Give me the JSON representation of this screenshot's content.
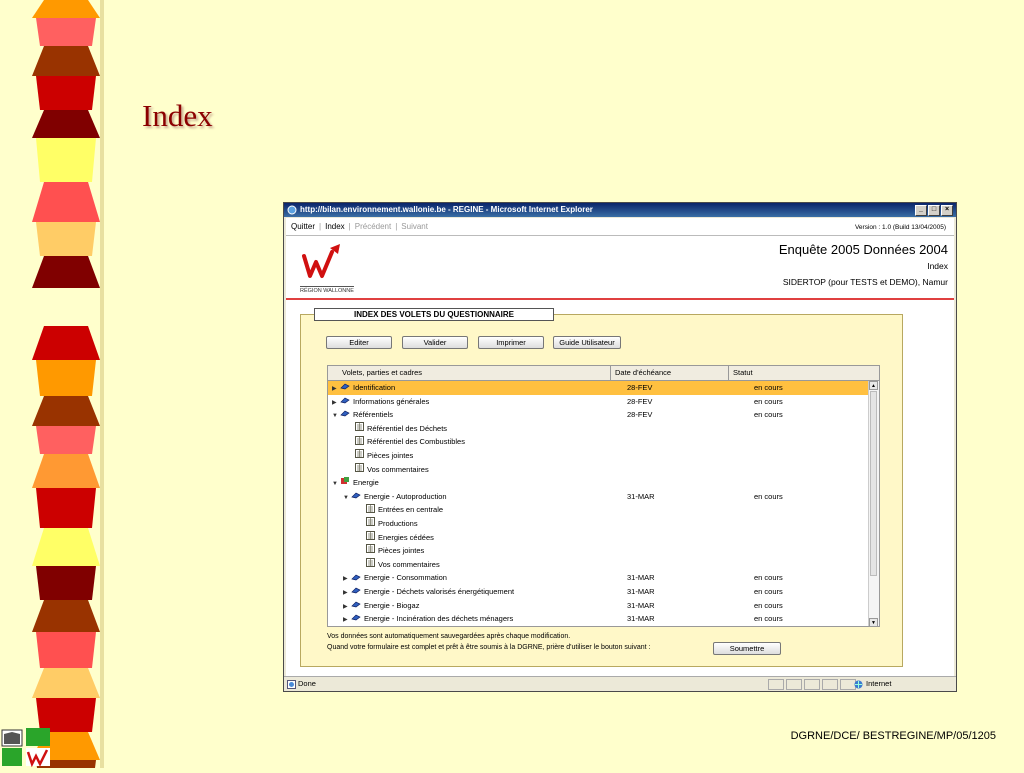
{
  "slide": {
    "title": "Index",
    "footer_ref": "DGRNE/DCE/ BESTREGINE/MP/05/1205"
  },
  "colors": {
    "background": "#ffffcc",
    "title": "#8b0000",
    "selected_row": "#ffc040",
    "header_rule": "#e04040",
    "panel": "#fff8c8"
  },
  "browser": {
    "title": "http://bilan.environnement.wallonie.be - REGINE - Microsoft Internet Explorer",
    "buttons": [
      "_",
      "□",
      "×"
    ],
    "status_text": "Done",
    "zone_text": "Internet"
  },
  "page": {
    "nav": {
      "quit": "Quitter",
      "index": "Index",
      "previous": "Précédent",
      "next": "Suivant"
    },
    "version": "Version : 1.0 (Build 13/04/2005)",
    "logo_caption": "RÉGION WALLONNE",
    "header_title": "Enquête 2005 Données 2004",
    "header_sub": "Index",
    "header_org": "SIDERTOP (pour TESTS et DEMO), Namur",
    "panel_title": "INDEX DES VOLETS DU QUESTIONNAIRE",
    "actions": {
      "edit": "Editer",
      "validate": "Valider",
      "print": "Imprimer",
      "guide": "Guide Utilisateur"
    },
    "table": {
      "columns": [
        "Volets, parties et cadres",
        "Date d'échéance",
        "Statut"
      ],
      "rows": [
        {
          "label": "Identification",
          "date": "28-FEV",
          "status": "en cours"
        },
        {
          "label": "Informations générales",
          "date": "28-FEV",
          "status": "en cours"
        },
        {
          "label": "Référentiels",
          "date": "28-FEV",
          "status": "en cours"
        },
        {
          "label": "Référentiel des Déchets",
          "date": "",
          "status": ""
        },
        {
          "label": "Référentiel des Combustibles",
          "date": "",
          "status": ""
        },
        {
          "label": "Pièces jointes",
          "date": "",
          "status": ""
        },
        {
          "label": "Vos commentaires",
          "date": "",
          "status": ""
        },
        {
          "label": "Energie",
          "date": "",
          "status": ""
        },
        {
          "label": "Energie - Autoproduction",
          "date": "31-MAR",
          "status": "en cours"
        },
        {
          "label": "Entrées en centrale",
          "date": "",
          "status": ""
        },
        {
          "label": "Productions",
          "date": "",
          "status": ""
        },
        {
          "label": "Energies cédées",
          "date": "",
          "status": ""
        },
        {
          "label": "Pièces jointes",
          "date": "",
          "status": ""
        },
        {
          "label": "Vos commentaires",
          "date": "",
          "status": ""
        },
        {
          "label": "Energie - Consommation",
          "date": "31-MAR",
          "status": "en cours"
        },
        {
          "label": "Energie - Déchets valorisés énergétiquement",
          "date": "31-MAR",
          "status": "en cours"
        },
        {
          "label": "Energie - Biogaz",
          "date": "31-MAR",
          "status": "en cours"
        },
        {
          "label": "Energie - Incinération des déchets ménagers",
          "date": "31-MAR",
          "status": "en cours"
        }
      ]
    },
    "note_line1": "Vos données sont automatiquement sauvegardées après chaque modification.",
    "note_line2": "Quand votre formulaire est complet et prêt à être soumis à la DGRNE, prière d'utiliser le bouton suivant :",
    "submit": "Soumettre"
  }
}
